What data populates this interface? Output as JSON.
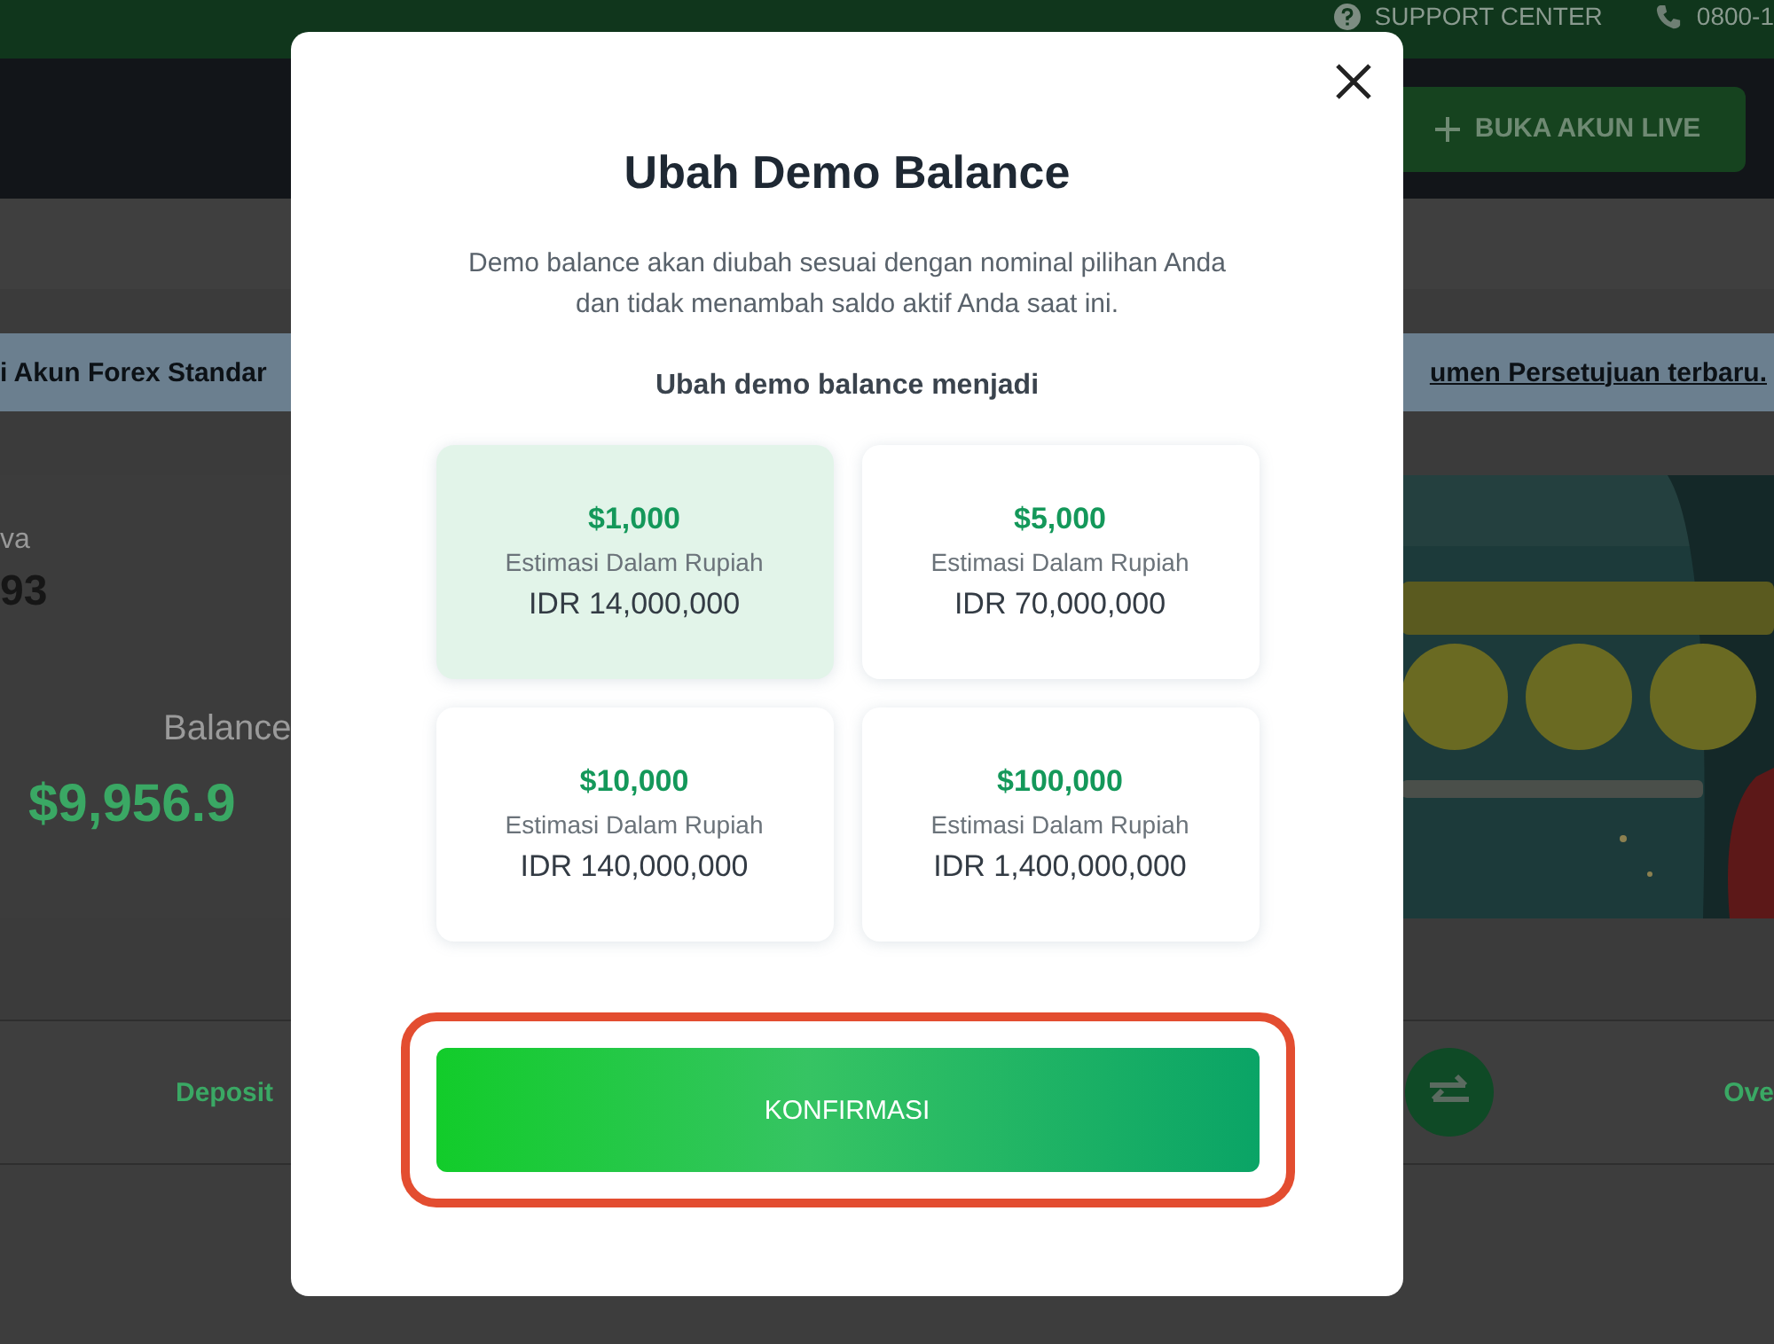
{
  "top_bar": {
    "support": "SUPPORT CENTER",
    "phone": "0800-1"
  },
  "header": {
    "cta": "BUKA AKUN LIVE"
  },
  "notice": {
    "left": "i Akun Forex Standar",
    "link": "umen Persetujuan terbaru."
  },
  "account": {
    "label": "va",
    "value": "93",
    "balance_label": "Balance",
    "balance": "$9,956.9"
  },
  "actions": {
    "left": "Deposit",
    "right": "Ove"
  },
  "modal": {
    "title": "Ubah Demo Balance",
    "description": "Demo balance akan diubah sesuai dengan nominal pilihan Anda dan tidak menambah saldo aktif Anda saat ini.",
    "prompt": "Ubah demo balance menjadi",
    "options": [
      {
        "amount": "$1,000",
        "caption": "Estimasi Dalam Rupiah",
        "idr": "IDR 14,000,000",
        "selected": true
      },
      {
        "amount": "$5,000",
        "caption": "Estimasi Dalam Rupiah",
        "idr": "IDR 70,000,000",
        "selected": false
      },
      {
        "amount": "$10,000",
        "caption": "Estimasi Dalam Rupiah",
        "idr": "IDR 140,000,000",
        "selected": false
      },
      {
        "amount": "$100,000",
        "caption": "Estimasi Dalam Rupiah",
        "idr": "IDR 1,400,000,000",
        "selected": false
      }
    ],
    "confirm": {
      "label": "KONFIRMASI",
      "highlighted": true
    }
  }
}
